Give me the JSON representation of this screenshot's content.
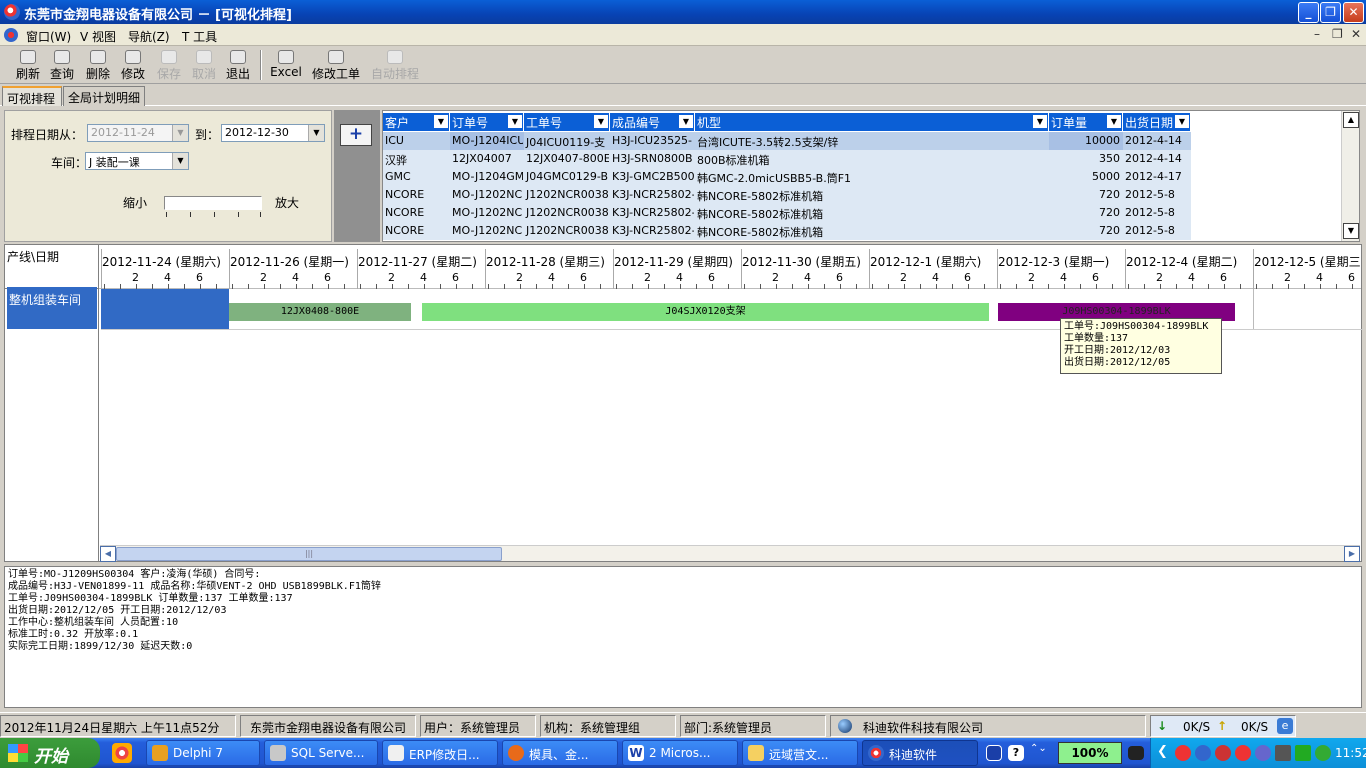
{
  "window": {
    "title": "东莞市金翔电器设备有限公司 － [可视化排程]"
  },
  "menu": {
    "items": [
      "窗口(W)",
      "V 视图",
      "导航(Z)",
      "T 工具"
    ]
  },
  "toolbar": {
    "buttons": [
      "刷新",
      "查询",
      "删除",
      "修改",
      "保存",
      "取消",
      "退出",
      "Excel",
      "修改工单",
      "自动排程"
    ],
    "disabled": [
      false,
      false,
      false,
      false,
      true,
      true,
      false,
      false,
      false,
      true
    ]
  },
  "tabs": [
    "可视排程",
    "全局计划明细"
  ],
  "filter": {
    "date_from_label": "排程日期从：",
    "date_from": "2012-11-24",
    "date_to_label": "到：",
    "date_to": "2012-12-30",
    "workshop_label": "车间：",
    "workshop": "J 装配一课",
    "zoom_out": "缩小",
    "zoom_in": "放大",
    "add_symbol": "+"
  },
  "grid": {
    "columns": [
      "客户",
      "订单号",
      "工单号",
      "成品编号",
      "机型",
      "订单量",
      "出货日期"
    ],
    "rows": [
      [
        "ICU",
        "MO-J1204ICU",
        "J04ICU0119-支",
        "H3J-ICU23525-",
        "台湾ICUTE-3.5转2.5支架/锌",
        "10000",
        "2012-4-14"
      ],
      [
        "汉骅",
        "12JX04007",
        "12JX0407-800E",
        "H3J-SRN0800B",
        "800B标准机箱",
        "350",
        "2012-4-14"
      ],
      [
        "GMC",
        "MO-J1204GM",
        "J04GMC0129-B",
        "K3J-GMC2B500",
        "韩GMC-2.0micUSBB5-B.筒F1",
        "5000",
        "2012-4-17"
      ],
      [
        "NCORE",
        "MO-J1202NC",
        "J1202NCR0038",
        "K3J-NCR25802-",
        "韩NCORE-5802标准机箱",
        "720",
        "2012-5-8"
      ],
      [
        "NCORE",
        "MO-J1202NC",
        "J1202NCR0038",
        "K3J-NCR25802-",
        "韩NCORE-5802标准机箱",
        "720",
        "2012-5-8"
      ],
      [
        "NCORE",
        "MO-J1202NC",
        "J1202NCR0038",
        "K3J-NCR25802-",
        "韩NCORE-5802标准机箱",
        "720",
        "2012-5-8"
      ]
    ]
  },
  "gantt": {
    "corner_label": "产线\\日期",
    "line": "整机组装车间",
    "days": [
      "2012-11-24 (星期六)",
      "2012-11-26 (星期一)",
      "2012-11-27 (星期二)",
      "2012-11-28 (星期三)",
      "2012-11-29 (星期四)",
      "2012-11-30 (星期五)",
      "2012-12-1 (星期六)",
      "2012-12-3 (星期一)",
      "2012-12-4 (星期二)",
      "2012-12-5 (星期三)"
    ],
    "hour_ticks": [
      "2",
      "4",
      "6"
    ],
    "bars": [
      {
        "label": "12JX0408-800E",
        "color": "#7fb27f"
      },
      {
        "label": "J04SJX0120支架",
        "color": "#7fe07f"
      },
      {
        "label": "J09HS00304-1899BLK",
        "color": "#800080"
      }
    ],
    "tooltip": [
      "工单号:J09HS00304-1899BLK",
      "工单数量:137",
      "开工日期:2012/12/03",
      "出货日期:2012/12/05"
    ]
  },
  "info": {
    "lines": [
      "订单号:MO-J1209HS00304 客户:凌海(华硕) 合同号:",
      "成品编号:H3J-VEN01899-11 成品名称:华硕VENT-2 OHD USB1899BLK.F1筒锌",
      "工单号:J09HS00304-1899BLK 订单数量:137 工单数量:137",
      "出货日期:2012/12/05 开工日期:2012/12/03",
      "工作中心:整机组装车间 人员配置:10",
      "标准工时:0.32 开放率:0.1",
      "实际完工日期:1899/12/30 延迟天数:0"
    ]
  },
  "status": {
    "datetime": "2012年11月24日星期六 上午11点52分",
    "company": "东莞市金翔电器设备有限公司",
    "user": "用户：系统管理员",
    "org": "机构：系统管理组",
    "dept": "部门:系统管理员",
    "vendor": "科迪软件科技有限公司",
    "down": "0K/S",
    "up": "0K/S"
  },
  "taskbar": {
    "start": "开始",
    "tasks": [
      "Delphi 7",
      "SQL Serve...",
      "ERP修改日...",
      "模具、金...",
      "2 Micros...",
      "远域营文...",
      "科迪软件"
    ],
    "zoom": "100%",
    "time": "11:52"
  }
}
